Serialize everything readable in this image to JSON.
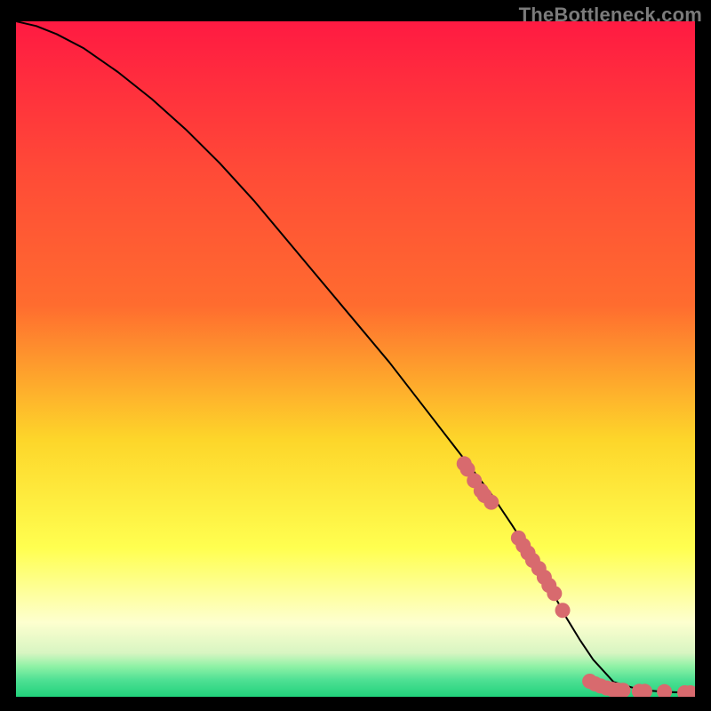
{
  "watermark": "TheBottleneck.com",
  "colors": {
    "background": "#000000",
    "gradient_top": "#ff1a42",
    "gradient_upper": "#ff6c2f",
    "gradient_mid": "#fdd62a",
    "gradient_lower_yellow": "#ffff50",
    "gradient_pale": "#fdffcf",
    "gradient_green_light": "#8ff2a6",
    "gradient_green": "#21d27b",
    "curve": "#000000",
    "points": "#d86a6e"
  },
  "chart_data": {
    "type": "line",
    "title": "",
    "xlabel": "",
    "ylabel": "",
    "xlim": [
      0,
      100
    ],
    "ylim": [
      0,
      100
    ],
    "curve": {
      "x": [
        0,
        3,
        6,
        10,
        15,
        20,
        25,
        30,
        35,
        40,
        45,
        50,
        55,
        60,
        65,
        70,
        73,
        76,
        79,
        81,
        83,
        85,
        88,
        92,
        96,
        100
      ],
      "y": [
        100,
        99.3,
        98.1,
        96.0,
        92.5,
        88.5,
        84.0,
        79.0,
        73.5,
        67.5,
        61.5,
        55.5,
        49.5,
        43.0,
        36.5,
        30.0,
        25.5,
        20.8,
        15.5,
        11.8,
        8.5,
        5.5,
        2.2,
        1.0,
        0.7,
        0.6
      ]
    },
    "series": [
      {
        "name": "points",
        "x": [
          66.0,
          66.5,
          67.5,
          68.5,
          69.0,
          70.0,
          74.0,
          74.7,
          75.4,
          76.1,
          77.0,
          77.8,
          78.5,
          79.3,
          80.5,
          84.5,
          85.3,
          86.1,
          87.0,
          87.8,
          88.6,
          89.4,
          91.8,
          92.6,
          95.5,
          98.5,
          99.3
        ],
        "y": [
          34.5,
          33.7,
          32.0,
          30.5,
          29.8,
          28.8,
          23.5,
          22.4,
          21.3,
          20.2,
          19.0,
          17.7,
          16.5,
          15.3,
          12.8,
          2.3,
          1.9,
          1.6,
          1.3,
          1.1,
          1.0,
          0.95,
          0.8,
          0.8,
          0.75,
          0.6,
          0.6
        ]
      }
    ]
  }
}
